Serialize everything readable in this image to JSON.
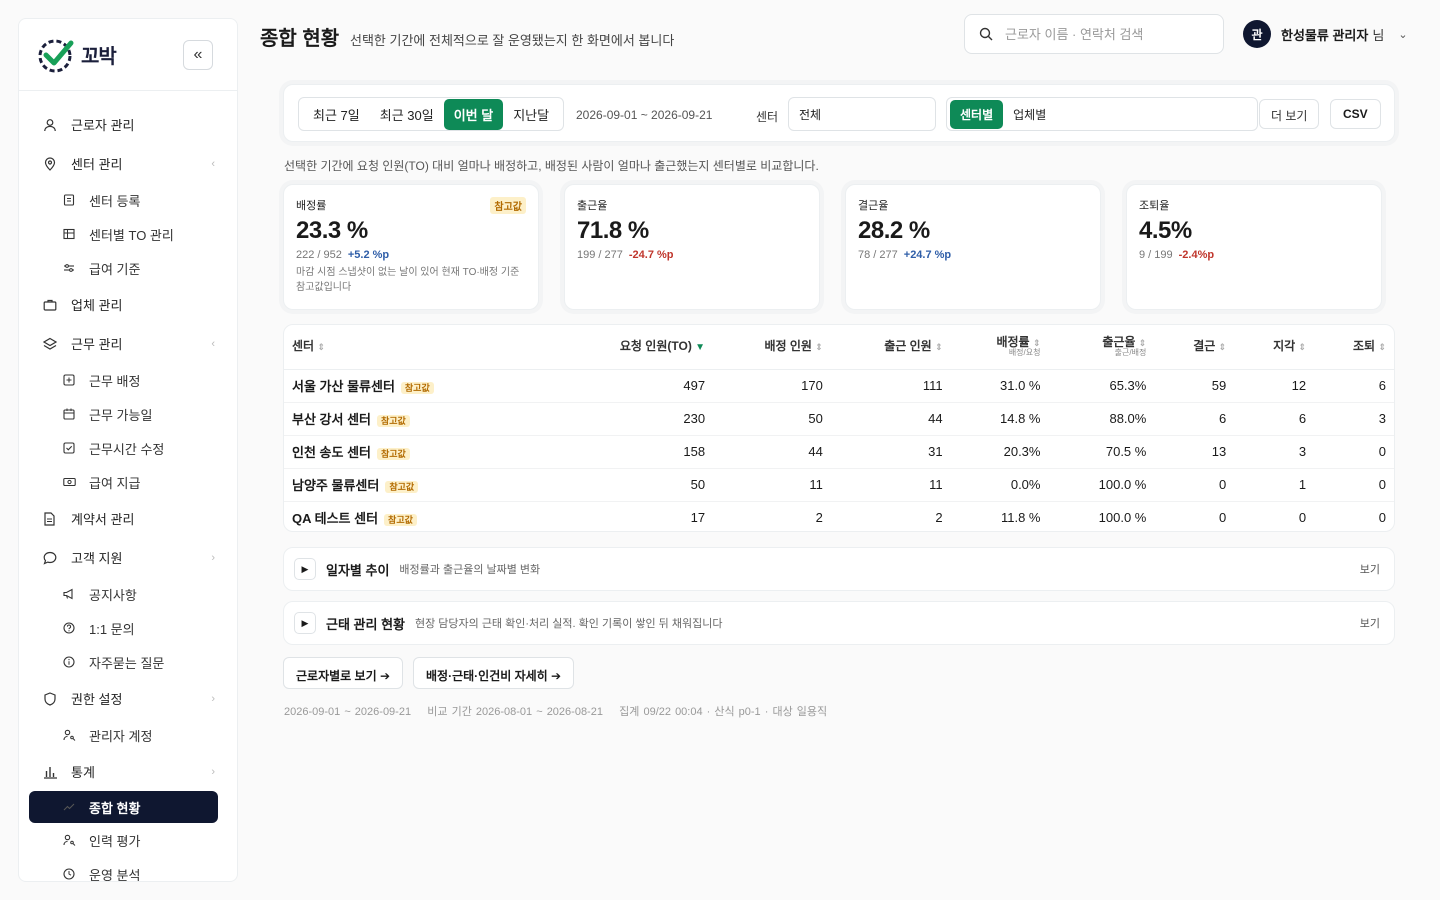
{
  "app": {
    "logo_text": "꼬박",
    "collapse_icon": "double-chevron-left-icon"
  },
  "sidebar": {
    "items": [
      {
        "label": "근로자 관리",
        "icon": "user-icon"
      },
      {
        "label": "센터 관리",
        "icon": "map-pin-icon",
        "chevron": "‹"
      },
      {
        "label": "센터 등록",
        "icon": "doc-icon",
        "sub": true
      },
      {
        "label": "센터별 TO 관리",
        "icon": "table-icon",
        "sub": true
      },
      {
        "label": "급여 기준",
        "icon": "sliders-icon",
        "sub": true
      },
      {
        "label": "업체 관리",
        "icon": "briefcase-icon"
      },
      {
        "label": "근무 관리",
        "icon": "layers-icon",
        "chevron": "‹"
      },
      {
        "label": "근무 배정",
        "icon": "plus-square-icon",
        "sub": true
      },
      {
        "label": "근무 가능일",
        "icon": "calendar-icon",
        "sub": true
      },
      {
        "label": "근무시간 수정",
        "icon": "check-square-icon",
        "sub": true
      },
      {
        "label": "급여 지급",
        "icon": "cash-icon",
        "sub": true
      },
      {
        "label": "계약서 관리",
        "icon": "contract-icon"
      },
      {
        "label": "고객 지원",
        "icon": "chat-icon",
        "chevron": "›"
      },
      {
        "label": "공지사항",
        "icon": "megaphone-icon",
        "sub": true
      },
      {
        "label": "1:1 문의",
        "icon": "question-icon",
        "sub": true
      },
      {
        "label": "자주묻는 질문",
        "icon": "info-icon",
        "sub": true
      },
      {
        "label": "권한 설정",
        "icon": "shield-icon",
        "chevron": "›"
      },
      {
        "label": "관리자 계정",
        "icon": "user-key-icon",
        "sub": true
      },
      {
        "label": "통계",
        "icon": "bar-chart-icon",
        "chevron": "›"
      },
      {
        "label": "종합 현황",
        "icon": "trend-icon",
        "sub": true,
        "active": true
      },
      {
        "label": "인력 평가",
        "icon": "user-key-icon",
        "sub": true
      },
      {
        "label": "운영 분석",
        "icon": "clock-icon",
        "sub": true
      }
    ]
  },
  "header": {
    "title": "종합 현황",
    "description": "선택한 기간에 전체적으로 잘 운영됐는지 한 화면에서 봅니다",
    "search_placeholder": "근로자 이름 · 연락처 검색",
    "user_avatar": "관",
    "user_name": "한성물류 관리자",
    "user_suffix": "님"
  },
  "filters": {
    "periods": [
      "최근 7일",
      "최근 30일",
      "이번 달",
      "지난달"
    ],
    "active_period": "이번 달",
    "date_range": "2026-09-01 ~ 2026-09-21",
    "center_label": "센터",
    "center_value": "전체",
    "views": [
      "센터별",
      "업체별"
    ],
    "active_view": "센터별",
    "more_label": "더 보기",
    "csv_label": "CSV"
  },
  "summary_desc": "선택한 기간에 요청 인원(TO) 대비 얼마나 배정하고, 배정된 사람이 얼마나 출근했는지 센터별로 비교합니다.",
  "kpis": [
    {
      "label": "배정률",
      "value": "23.3 %",
      "ratio": "222 / 952",
      "delta": "+5.2 %p",
      "trend": "up",
      "badge": "참고값",
      "note": "마감 시점 스냅샷이 없는 날이 있어 현재 TO·배정 기준 참고값입니다"
    },
    {
      "label": "출근율",
      "value": "71.8 %",
      "ratio": "199 / 277",
      "delta": "-24.7 %p",
      "trend": "down"
    },
    {
      "label": "결근율",
      "value": "28.2 %",
      "ratio": "78 / 277",
      "delta": "+24.7 %p",
      "trend": "up"
    },
    {
      "label": "조퇴율",
      "value": "4.5%",
      "ratio": "9 / 199",
      "delta": "-2.4%p",
      "trend": "down"
    }
  ],
  "table": {
    "headers": {
      "center": "센터",
      "to": "요청 인원(TO)",
      "assigned": "배정 인원",
      "attended": "출근 인원",
      "assign_rate": "배정률",
      "assign_rate_sub": "배정/요청",
      "attend_rate": "출근율",
      "attend_rate_sub": "출근/배정",
      "absent": "결근",
      "late": "지각",
      "early": "조퇴"
    },
    "ref_badge": "참고값",
    "rows": [
      {
        "center": "서울 가산 물류센터",
        "to": "497",
        "assigned": "170",
        "attended": "111",
        "assign_rate": "31.0 %",
        "attend_rate": "65.3%",
        "absent": "59",
        "late": "12",
        "early": "6"
      },
      {
        "center": "부산 강서 센터",
        "to": "230",
        "assigned": "50",
        "attended": "44",
        "assign_rate": "14.8 %",
        "attend_rate": "88.0%",
        "absent": "6",
        "late": "6",
        "early": "3"
      },
      {
        "center": "인천 송도 센터",
        "to": "158",
        "assigned": "44",
        "attended": "31",
        "assign_rate": "20.3%",
        "attend_rate": "70.5 %",
        "absent": "13",
        "late": "3",
        "early": "0"
      },
      {
        "center": "남양주 물류센터",
        "to": "50",
        "assigned": "11",
        "attended": "11",
        "assign_rate": "0.0%",
        "attend_rate": "100.0 %",
        "absent": "0",
        "late": "1",
        "early": "0"
      },
      {
        "center": "QA 테스트 센터",
        "to": "17",
        "assigned": "2",
        "attended": "2",
        "assign_rate": "11.8  %",
        "attend_rate": "100.0 %",
        "absent": "0",
        "late": "0",
        "early": "0"
      }
    ]
  },
  "panels": [
    {
      "title": "일자별 추이",
      "desc": "배정률과 출근율의 날짜별 변화",
      "view": "보기"
    },
    {
      "title": "근태 관리 현황",
      "desc": "현장 담당자의 근태 확인·처리 실적. 확인 기록이 쌓인 뒤 채워집니다",
      "view": "보기"
    }
  ],
  "links": [
    "근로자별로 보기 ➔",
    "배정·근태·인건비 자세히 ➔"
  ],
  "footer": "2026-09-01 ~ 2026-09-21    비교 기간 2026-08-01 ~ 2026-08-21    집계 09/22 00:04 · 산식 p0-1 · 대상 일용직",
  "colors": {
    "accent": "#0e8a57",
    "navy": "#0f1730",
    "up": "#2f5ea8",
    "down": "#c0362c",
    "badge_bg": "#fdf0c9"
  }
}
